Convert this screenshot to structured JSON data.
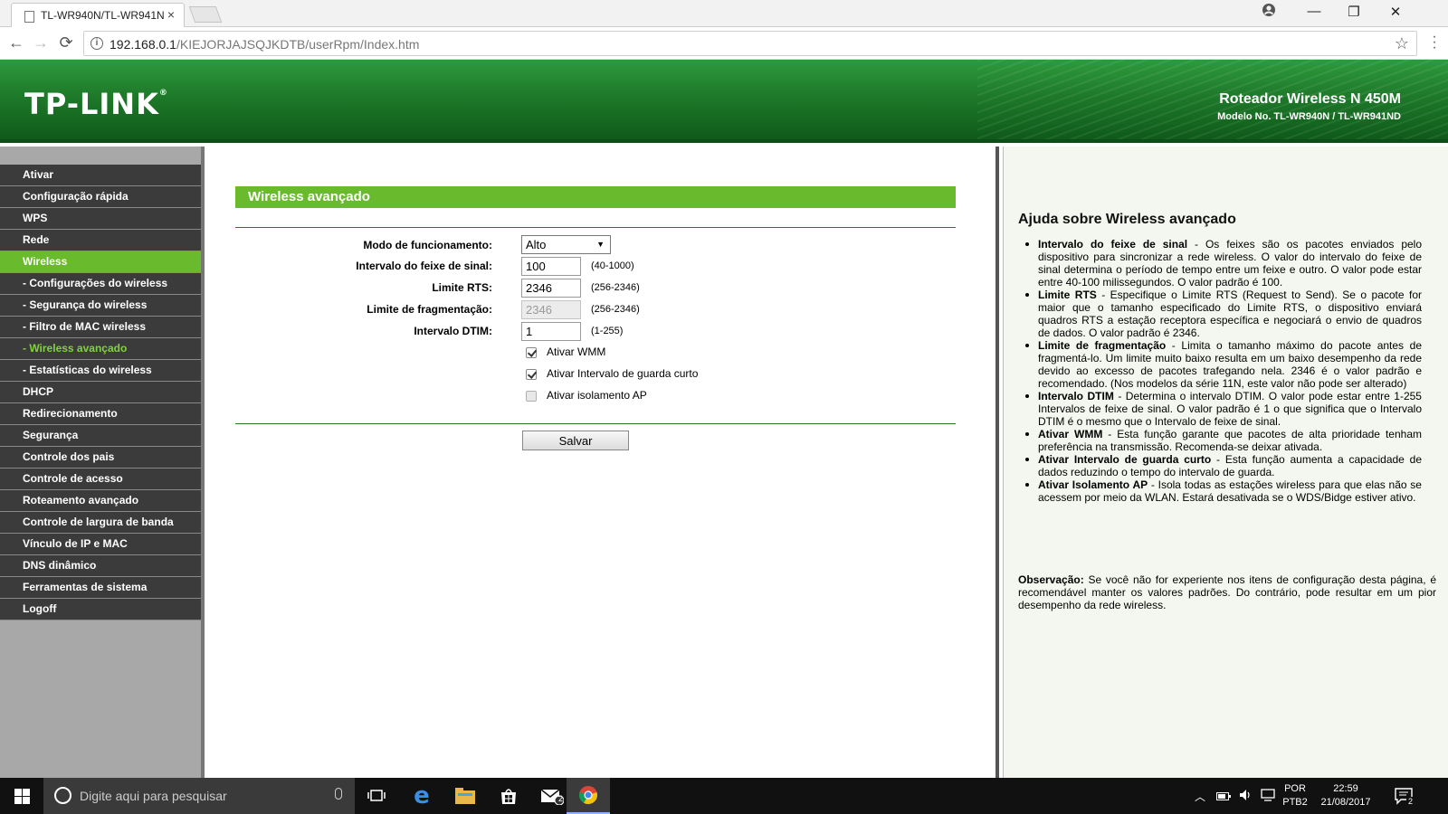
{
  "browser": {
    "tab_title": "TL-WR940N/TL-WR941N",
    "tab_close": "×",
    "url_host": "192.168.0.1",
    "url_path": "/KIEJORJAJSQJKDTB/userRpm/Index.htm",
    "back": "←",
    "forward": "→",
    "reload": "⟳",
    "star": "☆",
    "profile": "●",
    "minimize": "—",
    "maximize": "❐",
    "close": "✕"
  },
  "header": {
    "logo": "TP-LINK",
    "logo_mark": "®",
    "product": "Roteador Wireless N 450M",
    "model": "Modelo No. TL-WR940N / TL-WR941ND"
  },
  "sidebar": {
    "items": [
      {
        "label": "Ativar"
      },
      {
        "label": "Configuração rápida"
      },
      {
        "label": "WPS"
      },
      {
        "label": "Rede"
      },
      {
        "label": "Wireless"
      },
      {
        "label": "- Configurações do wireless"
      },
      {
        "label": "- Segurança do wireless"
      },
      {
        "label": "- Filtro de MAC wireless"
      },
      {
        "label": "- Wireless avançado"
      },
      {
        "label": "- Estatísticas do wireless"
      },
      {
        "label": "DHCP"
      },
      {
        "label": "Redirecionamento"
      },
      {
        "label": "Segurança"
      },
      {
        "label": "Controle dos pais"
      },
      {
        "label": "Controle de acesso"
      },
      {
        "label": "Roteamento avançado"
      },
      {
        "label": "Controle de largura de banda"
      },
      {
        "label": "Vínculo de IP e MAC"
      },
      {
        "label": "DNS dinâmico"
      },
      {
        "label": "Ferramentas de sistema"
      },
      {
        "label": "Logoff"
      }
    ]
  },
  "form": {
    "title": "Wireless avançado",
    "mode_label": "Modo de funcionamento:",
    "mode_value": "Alto",
    "beacon_label": "Intervalo do feixe de sinal:",
    "beacon_value": "100",
    "beacon_range": "(40-1000)",
    "rts_label": "Limite RTS:",
    "rts_value": "2346",
    "rts_range": "(256-2346)",
    "frag_label": "Limite de fragmentação:",
    "frag_value": "2346",
    "frag_range": "(256-2346)",
    "dtim_label": "Intervalo DTIM:",
    "dtim_value": "1",
    "dtim_range": "(1-255)",
    "wmm_label": "Ativar WMM",
    "wmm_checked": true,
    "guard_label": "Ativar Intervalo de guarda curto",
    "guard_checked": true,
    "isolation_label": "Ativar isolamento AP",
    "isolation_checked": false,
    "save_label": "Salvar"
  },
  "help": {
    "title": "Ajuda sobre Wireless avançado",
    "items": [
      {
        "term": "Intervalo do feixe de sinal",
        "text": " - Os feixes são os pacotes enviados pelo dispositivo para sincronizar a rede wireless. O valor do intervalo do feixe de sinal determina o período de tempo entre um feixe e outro. O valor pode estar entre 40-100 milissegundos. O valor padrão é 100."
      },
      {
        "term": "Limite RTS",
        "text": " - Especifique o Limite RTS (Request to Send). Se o pacote for maior que o tamanho especificado do Limite RTS, o dispositivo enviará quadros RTS a estação receptora específica e negociará o envio de quadros de dados. O valor padrão é 2346."
      },
      {
        "term": "Limite de fragmentação",
        "text": " - Limita o tamanho máximo do pacote antes de fragmentá-lo. Um limite muito baixo resulta em um baixo desempenho da rede devido ao excesso de pacotes trafegando nela. 2346 é o valor padrão e recomendado. (Nos modelos da série 11N, este valor não pode ser alterado)"
      },
      {
        "term": "Intervalo DTIM",
        "text": " - Determina o intervalo DTIM. O valor pode estar entre 1-255 Intervalos de feixe de sinal. O valor padrão é 1 o que significa que o Intervalo DTIM é o mesmo que o Intervalo de feixe de sinal."
      },
      {
        "term": "Ativar WMM",
        "text": " - Esta função garante que pacotes de alta prioridade tenham preferência na transmissão. Recomenda-se deixar ativada."
      },
      {
        "term": "Ativar Intervalo de guarda curto",
        "text": " - Esta função aumenta a capacidade de dados reduzindo o tempo do intervalo de guarda."
      },
      {
        "term": "Ativar Isolamento AP",
        "text": " - Isola todas as estações wireless para que elas não se acessem por meio da WLAN. Estará desativada se o WDS/Bidge estiver ativo."
      }
    ],
    "note_term": "Observação:",
    "note_text": " Se você não for experiente nos itens de configuração desta página, é recomendável manter os valores padrões. Do contrário, pode resultar em um pior desempenho da rede wireless."
  },
  "taskbar": {
    "search_placeholder": "Digite aqui para pesquisar",
    "lang_top": "POR",
    "lang_bottom": "PTB2",
    "time": "22:59",
    "date": "21/08/2017",
    "mail_badge": "2",
    "notif_badge": "2"
  }
}
